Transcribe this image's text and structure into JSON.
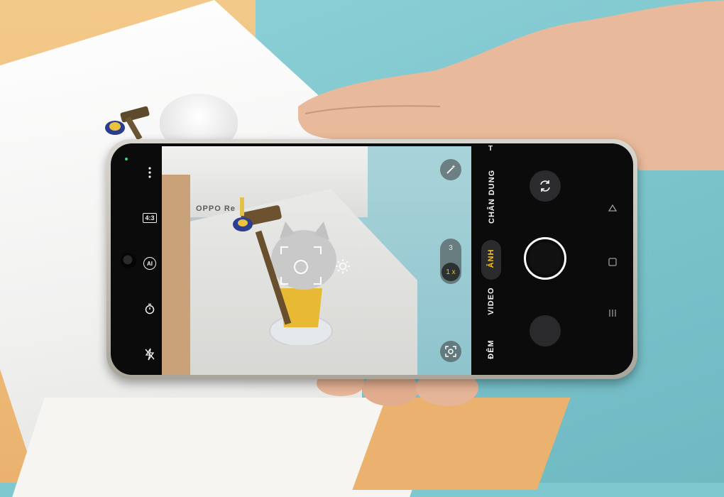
{
  "camera": {
    "top_cut_label": "T",
    "modes": [
      {
        "label": "CHÂN DUNG",
        "active": false
      },
      {
        "label": "ẢNH",
        "active": true
      },
      {
        "label": "VIDEO",
        "active": false
      },
      {
        "label": "ĐÊM",
        "active": false
      }
    ],
    "zoom": {
      "option": "3",
      "current": "1 x"
    },
    "aspect_ratio": "4:3",
    "ai_label": "AI",
    "viewfinder_logo": "OPPO Re",
    "icons": {
      "more": "more-vertical-icon",
      "ratio": "aspect-ratio-icon",
      "ai": "ai-scene-icon",
      "timer": "timer-icon",
      "flash": "flash-off-icon",
      "magic": "magic-wand-icon",
      "lens": "lens-icon",
      "switch": "switch-camera-icon",
      "exposure": "exposure-sun-icon"
    },
    "colors": {
      "accent": "#f5c11d",
      "panel": "#0b0b0c"
    }
  }
}
